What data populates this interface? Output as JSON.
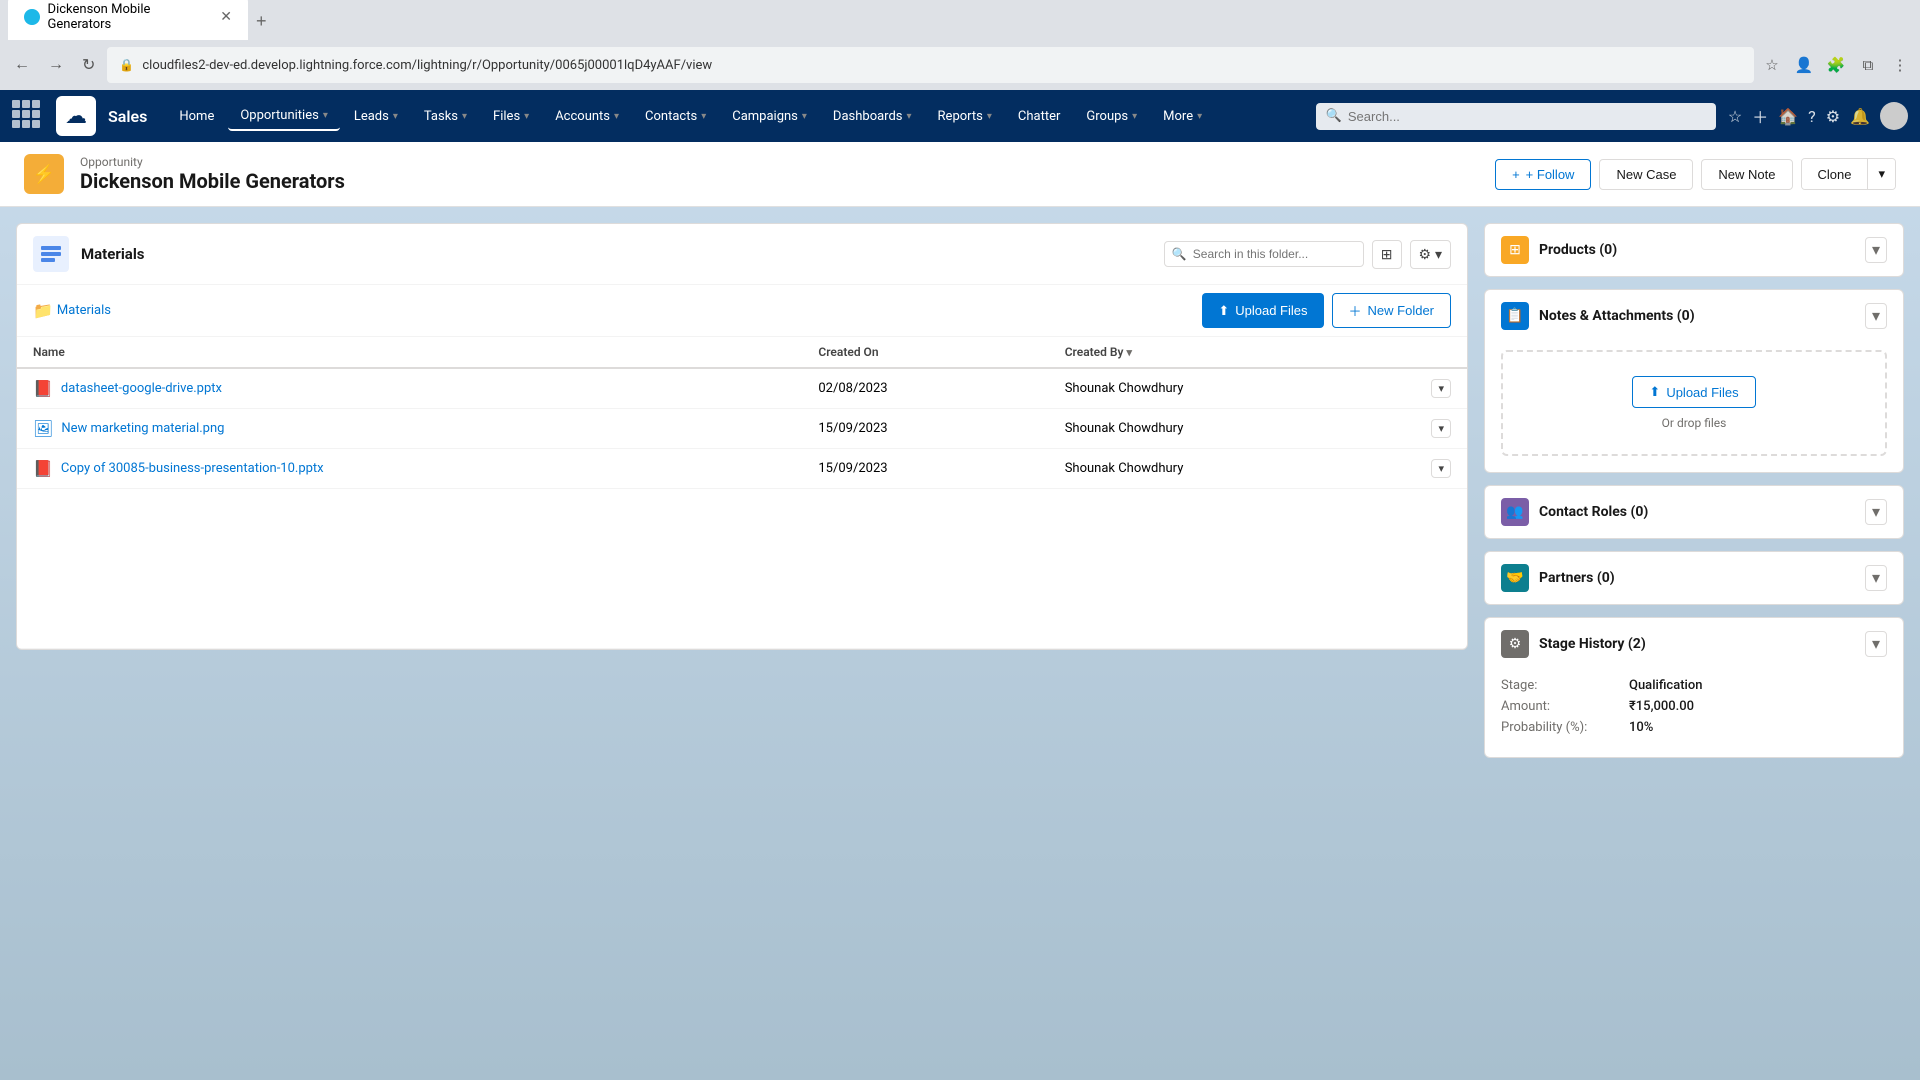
{
  "browser": {
    "tab_title": "Dickenson Mobile Generators",
    "url": "cloudfiles2-dev-ed.develop.lightning.force.com/lightning/r/Opportunity/0065j00001lqD4yAAF/view",
    "new_tab_label": "+"
  },
  "topnav": {
    "logo_symbol": "☁",
    "app_name": "Sales",
    "search_placeholder": "Search...",
    "nav_items": [
      {
        "label": "Home",
        "active": false
      },
      {
        "label": "Opportunities",
        "active": true,
        "has_dropdown": true
      },
      {
        "label": "Leads",
        "active": false,
        "has_dropdown": true
      },
      {
        "label": "Tasks",
        "active": false,
        "has_dropdown": true
      },
      {
        "label": "Files",
        "active": false,
        "has_dropdown": true
      },
      {
        "label": "Accounts",
        "active": false,
        "has_dropdown": true
      },
      {
        "label": "Contacts",
        "active": false,
        "has_dropdown": true
      },
      {
        "label": "Campaigns",
        "active": false,
        "has_dropdown": true
      },
      {
        "label": "Dashboards",
        "active": false,
        "has_dropdown": true
      },
      {
        "label": "Reports",
        "active": false,
        "has_dropdown": true
      },
      {
        "label": "Chatter",
        "active": false
      },
      {
        "label": "Groups",
        "active": false,
        "has_dropdown": true
      },
      {
        "label": "More",
        "active": false,
        "has_dropdown": true
      }
    ]
  },
  "record": {
    "type": "Opportunity",
    "title": "Dickenson Mobile Generators",
    "follow_label": "+ Follow",
    "new_case_label": "New Case",
    "new_note_label": "New Note",
    "clone_label": "Clone"
  },
  "materials": {
    "title": "Materials",
    "search_placeholder": "Search in this folder...",
    "folder_name": "Materials",
    "upload_btn": "Upload Files",
    "new_folder_btn": "New Folder",
    "columns": [
      {
        "label": "Name"
      },
      {
        "label": "Created On"
      },
      {
        "label": "Created By"
      }
    ],
    "files": [
      {
        "name": "datasheet-google-drive.pptx",
        "created_on": "02/08/2023",
        "created_by": "Shounak Chowdhury",
        "icon_type": "red"
      },
      {
        "name": "New marketing material.png",
        "created_on": "15/09/2023",
        "created_by": "Shounak Chowdhury",
        "icon_type": "blue"
      },
      {
        "name": "Copy of 30085-business-presentation-10.pptx",
        "created_on": "15/09/2023",
        "created_by": "Shounak Chowdhury",
        "icon_type": "red"
      }
    ]
  },
  "right_panels": {
    "products": {
      "title": "Products (0)",
      "icon_type": "orange",
      "icon_symbol": "⊞"
    },
    "notes": {
      "title": "Notes & Attachments (0)",
      "icon_type": "blue",
      "icon_symbol": "📄",
      "upload_btn": "Upload Files",
      "drop_text": "Or drop files"
    },
    "contact_roles": {
      "title": "Contact Roles (0)",
      "icon_type": "purple",
      "icon_symbol": "👥"
    },
    "partners": {
      "title": "Partners (0)",
      "icon_type": "teal",
      "icon_symbol": "🤝"
    },
    "stage_history": {
      "title": "Stage History (2)",
      "icon_type": "gray",
      "icon_symbol": "⚙",
      "stage_label": "Stage:",
      "stage_value": "Qualification",
      "amount_label": "Amount:",
      "amount_value": "₹15,000.00",
      "probability_label": "Probability (%):",
      "probability_value": "10%"
    }
  }
}
